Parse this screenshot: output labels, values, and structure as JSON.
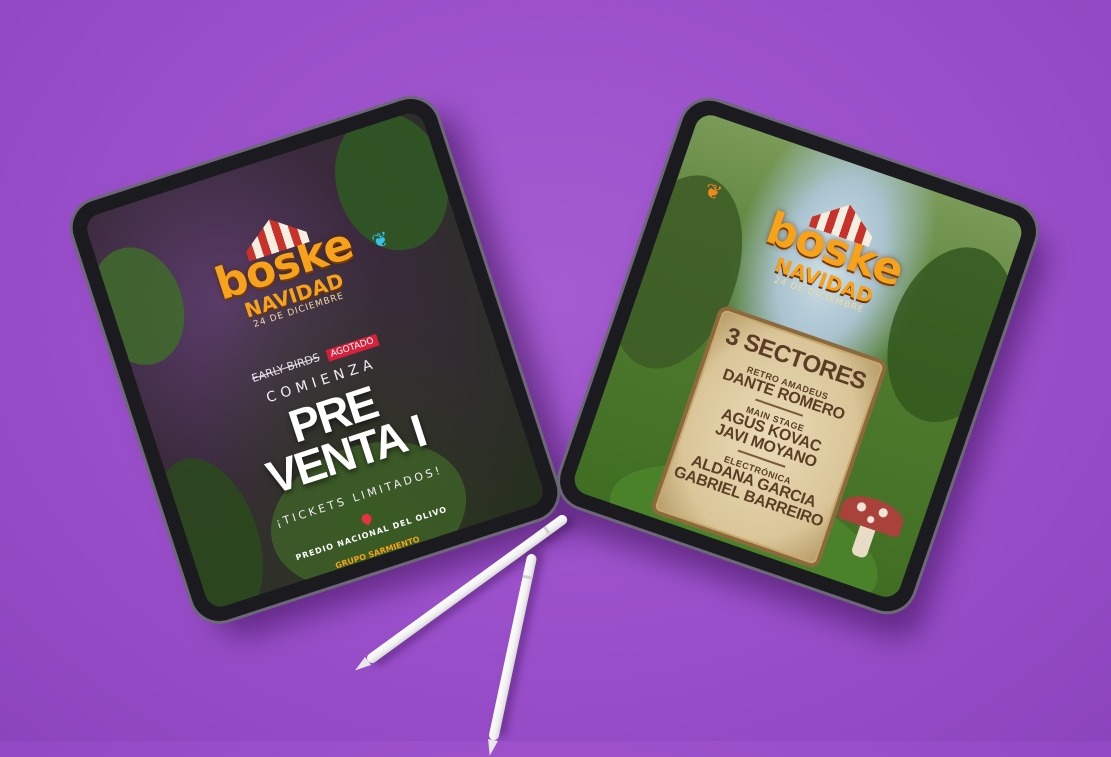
{
  "scene": {
    "background_color": "#9b50cb",
    "objects": [
      "tablet-left",
      "tablet-right",
      "stylus-pencil-1",
      "stylus-pencil-2"
    ]
  },
  "brand": {
    "logo_text": "boske",
    "event": "NAVIDAD",
    "date": "24 DE DICIEMBRE",
    "logo_color": "#f7a21b"
  },
  "tablet_left": {
    "early_birds": "EARLY BIRDS",
    "sold_out": "AGOTADO",
    "headline_top": "COMIENZA",
    "headline_line1": "PRE",
    "headline_line2": "VENTA I",
    "subline": "¡TICKETS LIMITADOS!",
    "venue": "PREDIO NACIONAL DEL OLIVO",
    "sponsor": "GRUPO SARMIENTO"
  },
  "tablet_right": {
    "title": "3 SECTORES",
    "stages": [
      {
        "label": "RETRO AMADEUS",
        "artists": [
          "DANTE ROMERO"
        ]
      },
      {
        "label": "MAIN STAGE",
        "artists": [
          "AGUS KOVAC",
          "JAVI MOYANO"
        ]
      },
      {
        "label": "ELECTRÓNICA",
        "artists": [
          "ALDANA GARCIA",
          "GABRIEL BARREIRO"
        ]
      }
    ]
  }
}
